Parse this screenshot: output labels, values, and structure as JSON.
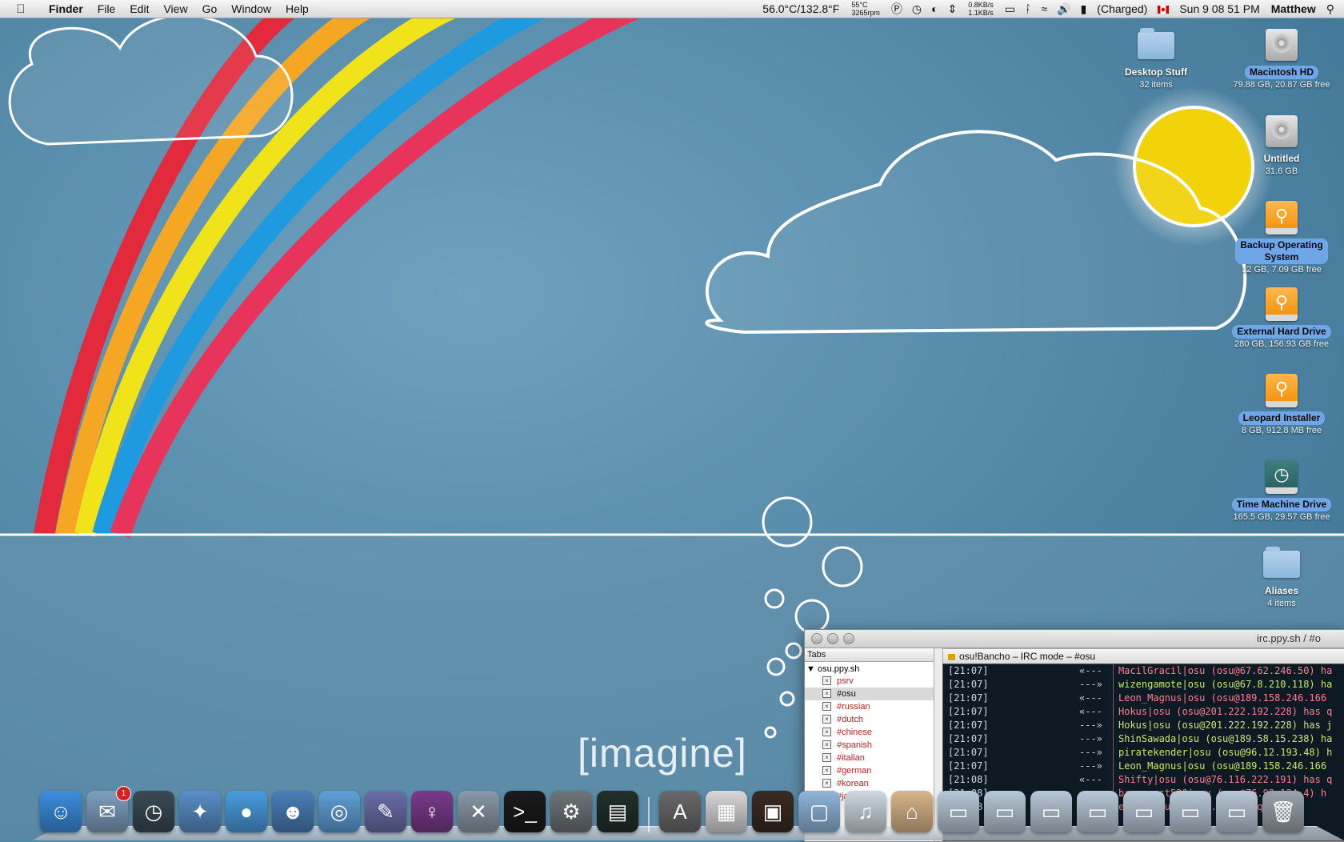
{
  "menubar": {
    "app_name": "Finder",
    "menus": [
      "File",
      "Edit",
      "View",
      "Go",
      "Window",
      "Help"
    ],
    "temperature": "56.0°C/132.8°F",
    "temp_small": "55°C",
    "fan_speed": "3265rpm",
    "net_up": "0.8KB/s",
    "net_down": "1.1KB/s",
    "battery_status": "(Charged)",
    "clock": "Sun 9 08 51 PM",
    "user": "Matthew"
  },
  "desktop_icons": [
    {
      "label": "Desktop Stuff",
      "sub": "32 items",
      "type": "folder",
      "selected": false
    },
    {
      "label": "Macintosh HD",
      "sub": "79.88 GB, 20.87 GB free",
      "type": "hdd",
      "selected": true
    },
    {
      "label": "Untitled",
      "sub": "31.6 GB",
      "type": "hdd",
      "selected": false
    },
    {
      "label": "Backup Operating System",
      "sub": "12 GB, 7.09 GB free",
      "type": "usb",
      "selected": true
    },
    {
      "label": "External Hard Drive",
      "sub": "280 GB, 156.93 GB free",
      "type": "usb",
      "selected": true
    },
    {
      "label": "Leopard Installer",
      "sub": "8 GB, 912.8 MB free",
      "type": "usb",
      "selected": true
    },
    {
      "label": "Time Machine Drive",
      "sub": "165.5 GB, 29.57 GB free",
      "type": "tm",
      "selected": true
    },
    {
      "label": "Aliases",
      "sub": "4 items",
      "type": "folder",
      "selected": false
    }
  ],
  "wallpaper": {
    "text": "[imagine]"
  },
  "irc": {
    "window_title": "irc.ppy.sh / #o",
    "tabs_header": "Tabs",
    "server": "osu.ppy.sh",
    "tabs": [
      "psrv",
      "#osu",
      "#russian",
      "#dutch",
      "#chinese",
      "#spanish",
      "#italian",
      "#german",
      "#korean",
      "#jap"
    ],
    "active_tab": "#osu",
    "channel_header": "osu!Bancho – IRC mode – #osu",
    "log": [
      {
        "ts": "[21:07]",
        "arrow": "«---",
        "text": "MacilGracil|osu (osu@67.62.246.50) ha",
        "kind": "part"
      },
      {
        "ts": "[21:07]",
        "arrow": "---»",
        "text": "wizengamote|osu (osu@67.8.210.118) ha",
        "kind": "join"
      },
      {
        "ts": "[21:07]",
        "arrow": "«---",
        "text": "Leon_Magnus|osu (osu@189.158.246.166",
        "kind": "part"
      },
      {
        "ts": "[21:07]",
        "arrow": "«---",
        "text": "Hokus|osu (osu@201.222.192.228) has q",
        "kind": "part"
      },
      {
        "ts": "[21:07]",
        "arrow": "---»",
        "text": "Hokus|osu (osu@201.222.192.228) has j",
        "kind": "join"
      },
      {
        "ts": "[21:07]",
        "arrow": "---»",
        "text": "ShinSawada|osu (osu@189.58.15.238) ha",
        "kind": "join"
      },
      {
        "ts": "[21:07]",
        "arrow": "---»",
        "text": "piratekender|osu (osu@96.12.193.48) h",
        "kind": "join"
      },
      {
        "ts": "[21:07]",
        "arrow": "---»",
        "text": "Leon_Magnus|osu (osu@189.158.246.166",
        "kind": "join"
      },
      {
        "ts": "[21:08]",
        "arrow": "«---",
        "text": "Shifty|osu (osu@76.116.222.191) has q",
        "kind": "part"
      },
      {
        "ts": "[21:08]",
        "arrow": "«---",
        "text": "browneast520|osu (osu@76.92.134.4) h",
        "kind": "part"
      },
      {
        "ts": "[21:08]",
        "arrow": "«---",
        "text": "ekfin|osu (osu@...) has q",
        "kind": "part"
      }
    ]
  },
  "dock": {
    "items": [
      {
        "name": "finder-icon",
        "glyph": "☺",
        "color": "#3b8ee0",
        "badge": ""
      },
      {
        "name": "mail-icon",
        "glyph": "✉",
        "color": "#7fa0c0",
        "badge": "1"
      },
      {
        "name": "time-machine-icon",
        "glyph": "◷",
        "color": "#3a4a55",
        "badge": ""
      },
      {
        "name": "safari-icon",
        "glyph": "✦",
        "color": "#5a8fc8",
        "badge": ""
      },
      {
        "name": "ichat-icon",
        "glyph": "●",
        "color": "#4a9de0",
        "badge": ""
      },
      {
        "name": "address-book-icon",
        "glyph": "☻",
        "color": "#4a7fb8",
        "badge": ""
      },
      {
        "name": "front-row-icon",
        "glyph": "◎",
        "color": "#5fa0d8",
        "badge": ""
      },
      {
        "name": "script-editor-icon",
        "glyph": "✎",
        "color": "#6a6ea8",
        "badge": ""
      },
      {
        "name": "adium-icon",
        "glyph": "♀",
        "color": "#7a3a8a",
        "badge": ""
      },
      {
        "name": "xcode-icon",
        "glyph": "✕",
        "color": "#8a9aa8",
        "badge": ""
      },
      {
        "name": "terminal-icon",
        "glyph": ">_",
        "color": "#1a1a1a",
        "badge": ""
      },
      {
        "name": "system-preferences-icon",
        "glyph": "⚙",
        "color": "#707478",
        "badge": ""
      },
      {
        "name": "activity-monitor-icon",
        "glyph": "▤",
        "color": "#22302a",
        "badge": ""
      },
      {
        "name": "applications-folder-icon",
        "glyph": "A",
        "color": "#6a6a6a",
        "badge": ""
      },
      {
        "name": "documents-stack-icon",
        "glyph": "▦",
        "color": "#d8d8d8",
        "badge": ""
      },
      {
        "name": "photos-stack-icon",
        "glyph": "▣",
        "color": "#3a2a22",
        "badge": ""
      },
      {
        "name": "downloads-folder-icon",
        "glyph": "▢",
        "color": "#8fb6dc",
        "badge": ""
      },
      {
        "name": "music-stack-icon",
        "glyph": "♫",
        "color": "#cfd8e0",
        "badge": ""
      },
      {
        "name": "home-folder-icon",
        "glyph": "⌂",
        "color": "#d9b68a",
        "badge": ""
      },
      {
        "name": "minimized-window-1-icon",
        "glyph": "▭",
        "color": "#b8c8d8",
        "badge": ""
      },
      {
        "name": "minimized-window-2-icon",
        "glyph": "▭",
        "color": "#b8c8d8",
        "badge": ""
      },
      {
        "name": "minimized-window-3-icon",
        "glyph": "▭",
        "color": "#b8c8d8",
        "badge": ""
      },
      {
        "name": "minimized-window-4-icon",
        "glyph": "▭",
        "color": "#b8c8d8",
        "badge": ""
      },
      {
        "name": "minimized-window-5-icon",
        "glyph": "▭",
        "color": "#b8c8d8",
        "badge": ""
      },
      {
        "name": "minimized-window-6-icon",
        "glyph": "▭",
        "color": "#b8c8d8",
        "badge": ""
      },
      {
        "name": "minimized-window-7-icon",
        "glyph": "▭",
        "color": "#b8c8d8",
        "badge": ""
      },
      {
        "name": "trash-icon",
        "glyph": "🗑",
        "color": "#9aa4ac",
        "badge": ""
      }
    ]
  }
}
